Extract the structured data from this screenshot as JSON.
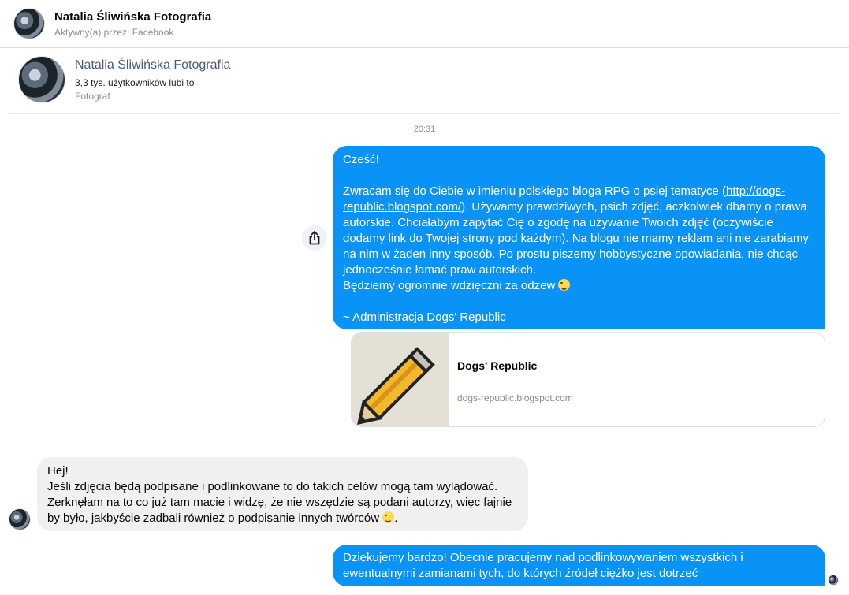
{
  "header": {
    "title": "Natalia Śliwińska Fotografia",
    "subtitle": "Aktywny(a) przez: Facebook"
  },
  "profile": {
    "name": "Natalia Śliwińska Fotografia",
    "likes": "3,3 tys. użytkowników lubi to",
    "category": "Fotograf"
  },
  "timestamp": "20:31",
  "messages": {
    "outgoing_1": {
      "greeting": "Cześć!",
      "body_before_link": "Zwracam się do Ciebie w imieniu polskiego bloga RPG o psiej tematyce (",
      "link_text": "http://dogs-republic.blogspot.com/",
      "body_after_link": "). Używamy prawdziwych, psich zdjęć, aczkolwiek dbamy o prawa autorskie. Chciałabym zapytać Cię o zgodę na używanie Twoich zdjęć (oczywiście dodamy link do Twojej strony pod każdym). Na blogu nie mamy reklam ani nie zarabiamy na nim w żaden inny sposób. Po prostu piszemy hobbystyczne opowiadania, nie chcąc jednocześnie łamać praw autorskich.",
      "thanks": "Będziemy ogromnie wdzięczni za odzew",
      "signature": "~ Administracja Dogs' Republic"
    },
    "link_preview": {
      "title": "Dogs' Republic",
      "domain": "dogs-republic.blogspot.com"
    },
    "incoming_1": {
      "line1": "Hej!",
      "body": "Jeśli zdjęcia będą podpisane i podlinkowane to do takich celów mogą tam wylądować. Zerknęłam na to co już tam macie i widzę, że nie wszędzie są podani autorzy, więc fajnie by było, jakbyście zadbali również o podpisanie innych twórców"
    },
    "outgoing_2": {
      "text": "Dziękujemy bardzo! Obecnie pracujemy nad podlinkowywaniem wszystkich i ewentualnymi zamianami tych, do których źródeł ciężko jest dotrzeć"
    }
  },
  "icons": {
    "share": "share-icon",
    "emoji_wink": "wink-emoji-icon",
    "emoji_smile": "smile-emoji-icon"
  },
  "colors": {
    "outgoing_bubble": "#0a93f7",
    "incoming_bubble": "#f0f0f0",
    "profile_name": "#4b5a7a"
  }
}
